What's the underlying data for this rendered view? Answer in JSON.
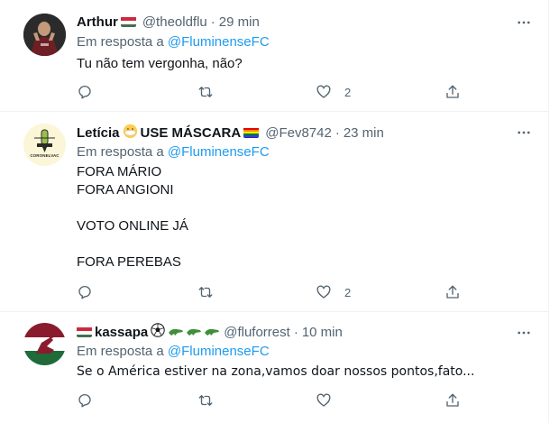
{
  "tweets": [
    {
      "name": "Arthur",
      "handle": "@theoldflu",
      "dot": "·",
      "time": "29 min",
      "reply_prefix": "Em resposta a",
      "reply_to": "@FluminenseFC",
      "text": "Tu não tem vergonha, não?",
      "counts": {
        "reply": "",
        "retweet": "",
        "like": "2",
        "share": ""
      }
    },
    {
      "name": "Letícia",
      "name_suffix": "USE MÁSCARA",
      "handle": "@Fev8742",
      "dot": "·",
      "time": "23 min",
      "reply_prefix": "Em resposta a",
      "reply_to": "@FluminenseFC",
      "text": "FORA MÁRIO\nFORA ANGIONI\n\nVOTO ONLINE JÁ\n\nFORA PEREBAS",
      "avatar_text": "CORONELVAC",
      "counts": {
        "reply": "",
        "retweet": "",
        "like": "2",
        "share": ""
      }
    },
    {
      "name": "kassapa",
      "handle": "@fluforrest",
      "dot": "·",
      "time": "10 min",
      "reply_prefix": "Em resposta a",
      "reply_to": "@FluminenseFC",
      "text": "Se o América estiver na zona,vamos doar nossos pontos,fato...",
      "counts": {
        "reply": "",
        "retweet": "",
        "like": "",
        "share": ""
      }
    }
  ],
  "icons": {
    "more": "more-horizontal-icon",
    "reply": "reply-bubble-icon",
    "retweet": "retweet-icon",
    "like": "heart-icon",
    "share": "share-icon"
  },
  "colors": {
    "link": "#1d9bf0",
    "secondary_text": "#536471",
    "primary_text": "#0f1419",
    "divider": "#eff3f4"
  }
}
